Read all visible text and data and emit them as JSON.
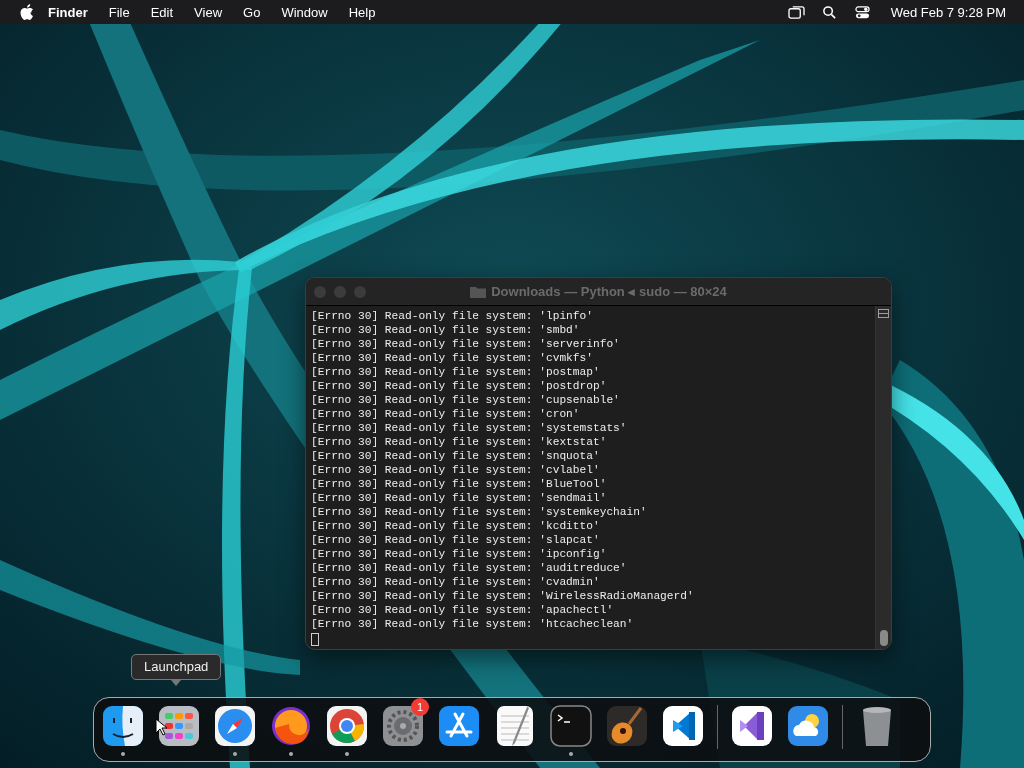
{
  "menu_bar": {
    "app": "Finder",
    "menus": [
      "File",
      "Edit",
      "View",
      "Go",
      "Window",
      "Help"
    ],
    "clock": "Wed Feb 7  9:28 PM"
  },
  "terminal": {
    "title": "Downloads — Python ◂ sudo — 80×24",
    "active": false,
    "lines": [
      "[Errno 30] Read-only file system: 'lpinfo'",
      "[Errno 30] Read-only file system: 'smbd'",
      "[Errno 30] Read-only file system: 'serverinfo'",
      "[Errno 30] Read-only file system: 'cvmkfs'",
      "[Errno 30] Read-only file system: 'postmap'",
      "[Errno 30] Read-only file system: 'postdrop'",
      "[Errno 30] Read-only file system: 'cupsenable'",
      "[Errno 30] Read-only file system: 'cron'",
      "[Errno 30] Read-only file system: 'systemstats'",
      "[Errno 30] Read-only file system: 'kextstat'",
      "[Errno 30] Read-only file system: 'snquota'",
      "[Errno 30] Read-only file system: 'cvlabel'",
      "[Errno 30] Read-only file system: 'BlueTool'",
      "[Errno 30] Read-only file system: 'sendmail'",
      "[Errno 30] Read-only file system: 'systemkeychain'",
      "[Errno 30] Read-only file system: 'kcditto'",
      "[Errno 30] Read-only file system: 'slapcat'",
      "[Errno 30] Read-only file system: 'ipconfig'",
      "[Errno 30] Read-only file system: 'auditreduce'",
      "[Errno 30] Read-only file system: 'cvadmin'",
      "[Errno 30] Read-only file system: 'WirelessRadioManagerd'",
      "[Errno 30] Read-only file system: 'apachectl'",
      "[Errno 30] Read-only file system: 'htcacheclean'"
    ]
  },
  "dock": {
    "tooltip": "Launchpad",
    "items": [
      {
        "kind": "app",
        "running": true
      },
      {
        "kind": "app",
        "running": false
      },
      {
        "kind": "app",
        "running": true
      },
      {
        "kind": "app",
        "running": true
      },
      {
        "kind": "app",
        "running": true
      },
      {
        "kind": "app",
        "running": false,
        "badge": "1"
      },
      {
        "kind": "app",
        "running": false
      },
      {
        "kind": "app",
        "running": false
      },
      {
        "kind": "app",
        "running": true
      },
      {
        "kind": "app",
        "running": false
      },
      {
        "kind": "app",
        "running": false
      },
      {
        "kind": "separator"
      },
      {
        "kind": "app",
        "running": false
      },
      {
        "kind": "app",
        "running": false
      },
      {
        "kind": "separator"
      },
      {
        "kind": "app",
        "running": false
      }
    ]
  }
}
